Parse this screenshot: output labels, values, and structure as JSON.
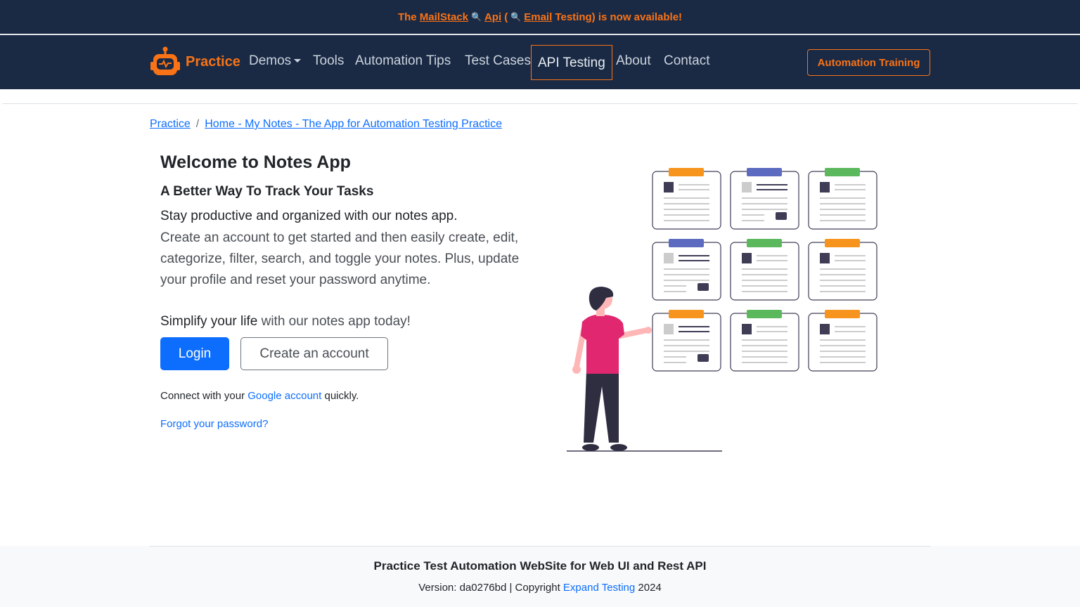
{
  "announcement": {
    "prefix": "The",
    "mailstack": "MailStack",
    "api": "Api",
    "paren_open": "(",
    "email": "Email",
    "suffix": "Testing) is now available!",
    "icon": "magnifier-icon"
  },
  "navbar": {
    "brand": "Practice",
    "items": [
      {
        "label": "Demos",
        "dropdown": true
      },
      {
        "label": "Tools"
      },
      {
        "label": "Automation Tips"
      },
      {
        "label": "Test Cases"
      },
      {
        "label": "API Testing",
        "active": true
      },
      {
        "label": "About"
      },
      {
        "label": "Contact"
      }
    ],
    "training_button": "Automation Training"
  },
  "breadcrumb": {
    "root": "Practice",
    "separator": "/",
    "current": "Home - My Notes - The App for Automation Testing Practice"
  },
  "main": {
    "title": "Welcome to Notes App",
    "subtitle": "A Better Way To Track Your Tasks",
    "lead": "Stay productive and organized with our notes app.",
    "description": "Create an account to get started and then easily create, edit, categorize, filter, search, and toggle your notes. Plus, update your profile and reset your password anytime.",
    "simplify_strong": "Simplify your life",
    "simplify_rest": " with our notes app today!",
    "login_button": "Login",
    "create_button": "Create an account",
    "google_prefix": "Connect with your ",
    "google_link": "Google account",
    "google_suffix": " quickly.",
    "forgot": "Forgot your password?"
  },
  "footer": {
    "title": "Practice Test Automation WebSite for Web UI and Rest API",
    "version_prefix": "Version: da0276bd | Copyright ",
    "company": "Expand Testing",
    "year": " 2024"
  },
  "colors": {
    "navy": "#1a2a45",
    "orange": "#f97316",
    "primary": "#0d6efd",
    "tab_orange": "#f7941d",
    "tab_purple": "#5c6bc0",
    "tab_green": "#5cb85c"
  }
}
